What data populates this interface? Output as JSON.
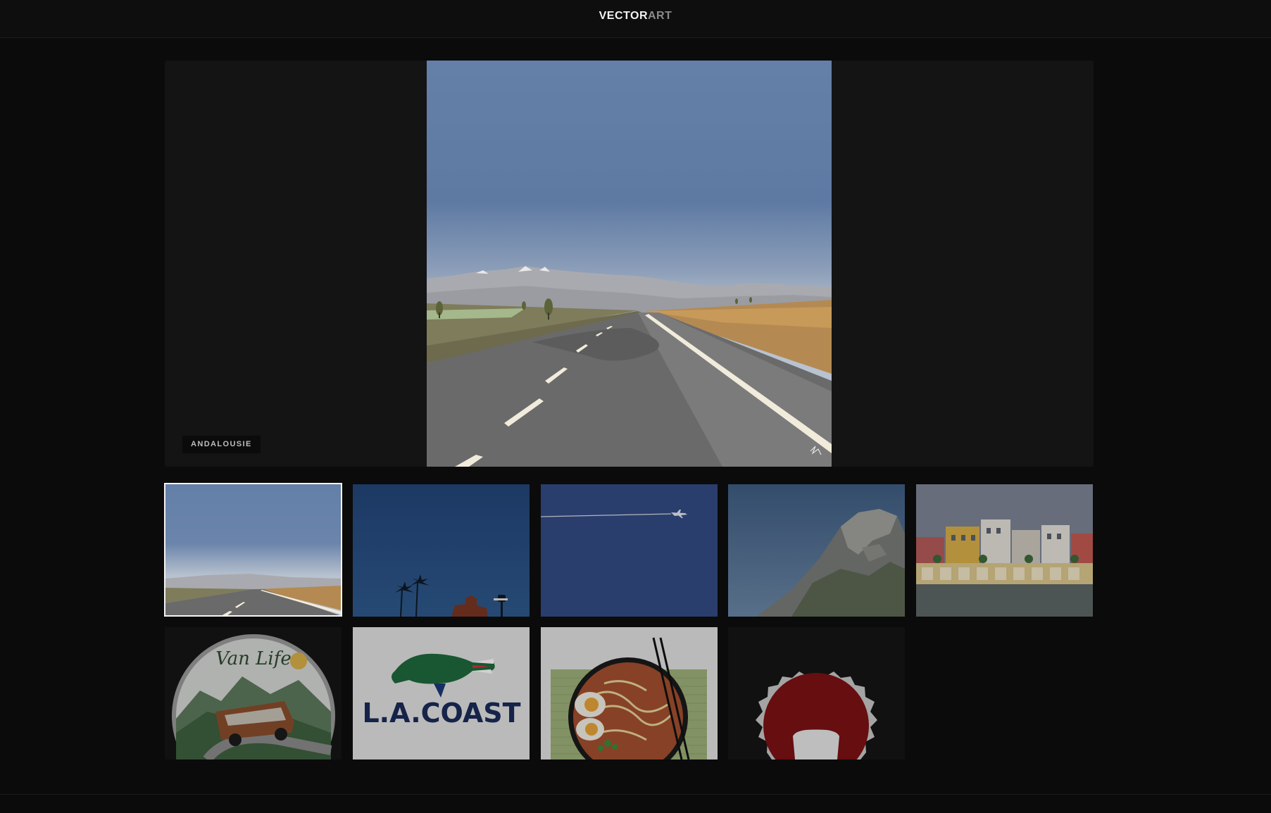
{
  "header": {
    "brand_part1": "VECTOR",
    "brand_part2": "ART"
  },
  "viewer": {
    "caption": "ANDALOUSIE",
    "image_icon": "andalusian-road-illustration",
    "signature_icon": "artist-signature-icon"
  },
  "gallery": {
    "selected_index": 0,
    "thumbnails": [
      {
        "subject": "andalusian-road"
      },
      {
        "subject": "palm-trees-night"
      },
      {
        "subject": "airplane-sky"
      },
      {
        "subject": "rocky-mountain"
      },
      {
        "subject": "seville-riverside-buildings"
      },
      {
        "subject": "van-life-badge",
        "text": "Van Life"
      },
      {
        "subject": "crocodile-logo",
        "text": "L.A.COAST"
      },
      {
        "subject": "ramen-bowl"
      },
      {
        "subject": "red-badge"
      }
    ]
  },
  "colors": {
    "background": "#0b0b0b",
    "panel": "#141414",
    "sky_top": "#6480a8",
    "sky_bottom": "#b9c2cf",
    "selection_border": "#f4f4f4"
  }
}
